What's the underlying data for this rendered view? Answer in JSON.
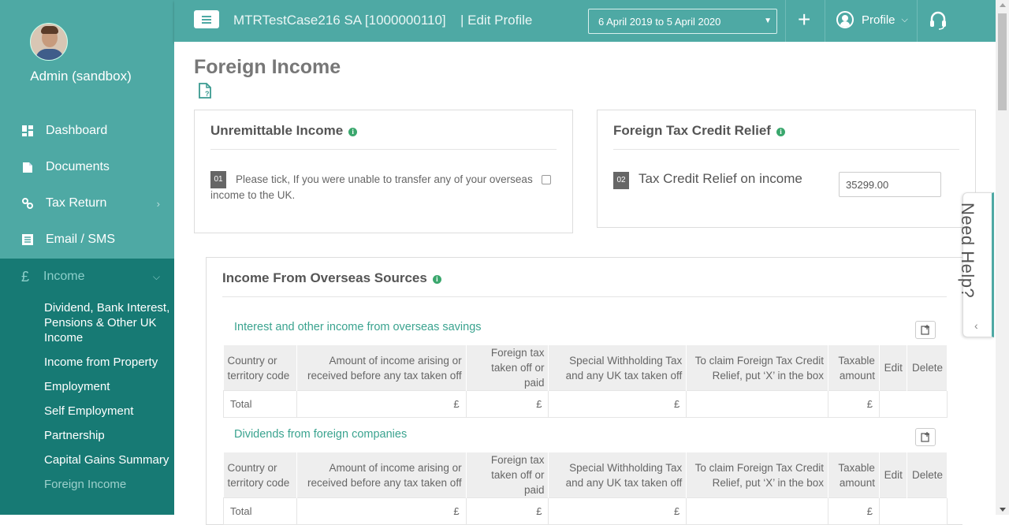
{
  "user": {
    "name": "Admin (sandbox)"
  },
  "nav": [
    {
      "label": "Dashboard",
      "icon": "dashboard-icon"
    },
    {
      "label": "Documents",
      "icon": "documents-icon"
    },
    {
      "label": "Tax Return",
      "icon": "tax-return-icon"
    },
    {
      "label": "Email / SMS",
      "icon": "email-icon"
    }
  ],
  "income_menu": {
    "label": "Income",
    "icon_glyph": "£",
    "items": [
      "Dividend, Bank Interest, Pensions & Other UK Income",
      "Income from Property",
      "Employment",
      "Self Employment",
      "Partnership",
      "Capital Gains Summary",
      "Foreign Income"
    ],
    "active_item": "Foreign Income"
  },
  "header": {
    "client": "MTRTestCase216 SA [1000000110]",
    "mode": "| Edit Profile",
    "period": "6 April 2019 to 5 April 2020",
    "profile_label": "Profile"
  },
  "page": {
    "title": "Foreign Income"
  },
  "unremittable": {
    "title": "Unremittable Income",
    "number": "01",
    "question": "Please tick, If you were unable to transfer any of your overseas income to the UK.",
    "checked": false
  },
  "ftcr": {
    "title": "Foreign Tax Credit Relief",
    "number": "02",
    "label": "Tax Credit Relief on income",
    "value": "35299.00"
  },
  "overseas": {
    "title": "Income From Overseas Sources",
    "columns": [
      "Country or territory code",
      "Amount of income arising or received before any tax taken off",
      "Foreign tax taken off or paid",
      "Special Withholding Tax and any UK tax taken off",
      "To claim Foreign Tax Credit Relief, put ‘X’ in the box",
      "Taxable amount",
      "Edit",
      "Delete"
    ],
    "sections": [
      {
        "title": "Interest and other income from overseas savings",
        "total_label": "Total",
        "currency": "£"
      },
      {
        "title": "Dividends from foreign companies",
        "total_label": "Total",
        "currency": "£"
      }
    ]
  },
  "help": {
    "label": "Need Help?"
  },
  "colors": {
    "teal": "#4ea9a4",
    "dark_teal": "#177a74",
    "accent_green": "#3aa38f"
  }
}
